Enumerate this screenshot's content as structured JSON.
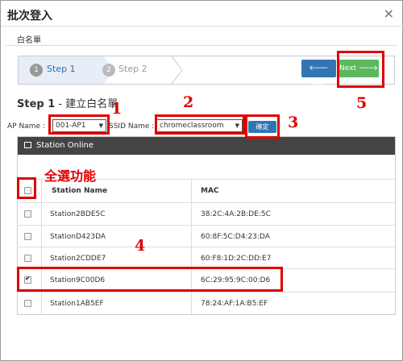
{
  "dialog": {
    "title": "批次登入"
  },
  "section_tab": "白名單",
  "wizard": {
    "step1_num": "1",
    "step1_label": "Step 1",
    "step2_num": "2",
    "step2_label": "Step 2",
    "prev_label": "Prev",
    "next_label": "Next"
  },
  "heading": {
    "bold": "Step 1",
    "rest": " - 建立白名單"
  },
  "form": {
    "ap_label": "AP Name :",
    "ap_value": "001-AP1",
    "ssid_label": "SSID Name :",
    "ssid_value": "chromeclassroom",
    "confirm_label": "確定"
  },
  "panel": {
    "title": "Station Online"
  },
  "table": {
    "headers": [
      "Station Name",
      "MAC"
    ],
    "rows": [
      {
        "name": "Station2BDE5C",
        "mac": "38:2C:4A:2B:DE:5C",
        "checked": false
      },
      {
        "name": "StationD423DA",
        "mac": "60:8F:5C:D4:23:DA",
        "checked": false
      },
      {
        "name": "Station2CDDE7",
        "mac": "60:F8:1D:2C:DD:E7",
        "checked": false
      },
      {
        "name": "Station9C00D6",
        "mac": "6C:29:95:9C:00:D6",
        "checked": true
      },
      {
        "name": "Station1AB5EF",
        "mac": "78:24:AF:1A:B5:EF",
        "checked": false
      }
    ]
  },
  "annotations": {
    "n1": "1",
    "n2": "2",
    "n3": "3",
    "n4": "4",
    "n5": "5",
    "select_all": "全選功能"
  },
  "colors": {
    "accent": "#3276b1",
    "success": "#5cb85c",
    "annotation": "#e00000"
  }
}
